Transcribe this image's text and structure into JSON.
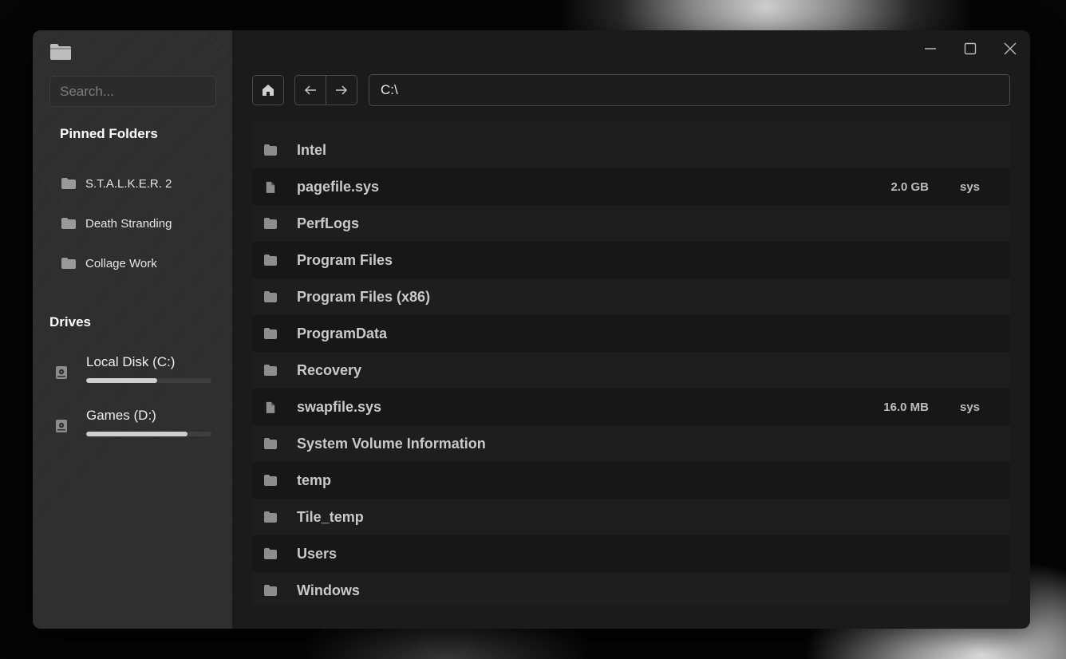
{
  "window": {
    "controls": {
      "minimize_icon": "minimize-icon",
      "maximize_icon": "maximize-icon",
      "close_icon": "close-icon"
    }
  },
  "sidebar": {
    "app_icon": "folder-icon",
    "search_placeholder": "Search...",
    "pinned_title": "Pinned Folders",
    "pinned": [
      {
        "label": "S.T.A.L.K.E.R. 2",
        "icon": "folder-icon"
      },
      {
        "label": "Death Stranding",
        "icon": "folder-icon"
      },
      {
        "label": "Collage Work",
        "icon": "folder-icon"
      }
    ],
    "drives_title": "Drives",
    "drives": [
      {
        "label": "Local Disk (C:)",
        "icon": "drive-icon",
        "usage": 0.57
      },
      {
        "label": "Games (D:)",
        "icon": "drive-icon",
        "usage": 0.81
      }
    ]
  },
  "toolbar": {
    "home_icon": "home-icon",
    "back_icon": "arrow-left-icon",
    "forward_icon": "arrow-right-icon",
    "address": "C:\\"
  },
  "files": [
    {
      "name": "Intel",
      "kind": "folder",
      "size": "",
      "type": ""
    },
    {
      "name": "pagefile.sys",
      "kind": "file",
      "size": "2.0 GB",
      "type": "sys"
    },
    {
      "name": "PerfLogs",
      "kind": "folder",
      "size": "",
      "type": ""
    },
    {
      "name": "Program Files",
      "kind": "folder",
      "size": "",
      "type": ""
    },
    {
      "name": "Program Files (x86)",
      "kind": "folder",
      "size": "",
      "type": ""
    },
    {
      "name": "ProgramData",
      "kind": "folder",
      "size": "",
      "type": ""
    },
    {
      "name": "Recovery",
      "kind": "folder",
      "size": "",
      "type": ""
    },
    {
      "name": "swapfile.sys",
      "kind": "file",
      "size": "16.0 MB",
      "type": "sys"
    },
    {
      "name": "System Volume Information",
      "kind": "folder",
      "size": "",
      "type": ""
    },
    {
      "name": "temp",
      "kind": "folder",
      "size": "",
      "type": ""
    },
    {
      "name": "Tile_temp",
      "kind": "folder",
      "size": "",
      "type": ""
    },
    {
      "name": "Users",
      "kind": "folder",
      "size": "",
      "type": ""
    },
    {
      "name": "Windows",
      "kind": "folder",
      "size": "",
      "type": ""
    }
  ]
}
